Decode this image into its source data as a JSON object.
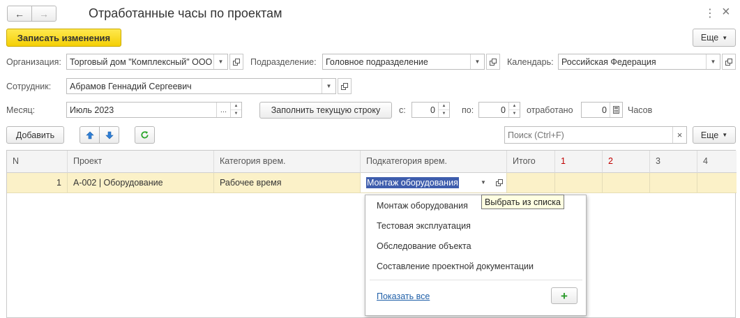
{
  "window": {
    "title": "Отработанные часы по проектам",
    "more_symbol": "⋮",
    "close_symbol": "×"
  },
  "toolbar": {
    "save_label": "Записать изменения",
    "more_label": "Еще"
  },
  "form": {
    "org_label": "Организация:",
    "org_value": "Торговый дом \"Комплексный\" ООО",
    "dept_label": "Подразделение:",
    "dept_value": "Головное подразделение",
    "calendar_label": "Календарь:",
    "calendar_value": "Российская Федерация",
    "employee_label": "Сотрудник:",
    "employee_value": "Абрамов Геннадий Сергеевич",
    "month_label": "Месяц:",
    "month_value": "Июль 2023",
    "fill_row_label": "Заполнить текущую строку",
    "from_label": "с:",
    "from_value": "0",
    "to_label": "по:",
    "to_value": "0",
    "worked_label": "отработано",
    "worked_value": "0",
    "hours_label": "Часов"
  },
  "table_toolbar": {
    "add_label": "Добавить",
    "search_placeholder": "Поиск (Ctrl+F)",
    "more_label": "Еще"
  },
  "table": {
    "columns": [
      "N",
      "Проект",
      "Категория врем.",
      "Подкатегория врем.",
      "Итого",
      "1",
      "2",
      "3",
      "4"
    ],
    "rows": [
      {
        "n": "1",
        "project": "А-002 | Оборудование",
        "category": "Рабочее время",
        "subcategory": "Монтаж оборудования"
      }
    ]
  },
  "dropdown": {
    "items": [
      "Монтаж оборудования",
      "Тестовая эксплуатация",
      "Обследование объекта",
      "Составление проектной документации"
    ],
    "show_all_label": "Показать все",
    "add_symbol": "+"
  },
  "tooltip": {
    "text": "Выбрать из списка"
  },
  "colors": {
    "accent_yellow": "#f4cf05",
    "weekend_red": "#c00000",
    "selection_blue": "#3e5dad",
    "row_highlight": "#fbf1c8",
    "arrow_blue": "#2f7fd6",
    "refresh_green": "#2aa52a"
  }
}
